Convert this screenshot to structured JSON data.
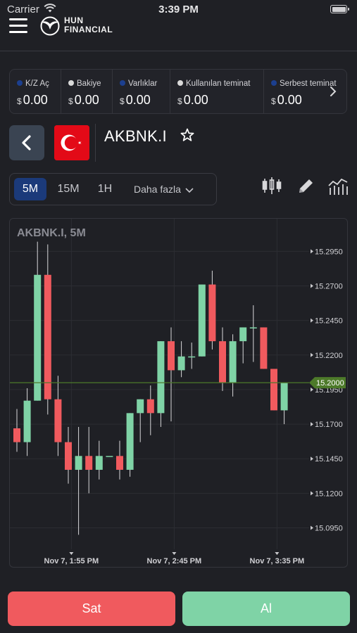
{
  "status_bar": {
    "carrier": "Carrier",
    "time": "3:39 PM"
  },
  "header": {
    "logo_line1": "HUN",
    "logo_line2": "FINANCIAL"
  },
  "stats": [
    {
      "label": "K/Z Aç",
      "dot_color": "#1c3f8f",
      "currency": "$",
      "value": "0.00"
    },
    {
      "label": "Bakiye",
      "dot_color": "#d9d9d9",
      "currency": "$",
      "value": "0.00"
    },
    {
      "label": "Varlıklar",
      "dot_color": "#1c3f8f",
      "currency": "$",
      "value": "0.00"
    },
    {
      "label": "Kullanılan teminat",
      "dot_color": "#d9d9d9",
      "currency": "$",
      "value": "0.00"
    },
    {
      "label": "Serbest teminat",
      "dot_color": "#1c3f8f",
      "currency": "$",
      "value": "0.00"
    }
  ],
  "symbol": {
    "name": "AKBNK.I",
    "flag": "turkey-flag"
  },
  "timeframes": {
    "items": [
      "5M",
      "15M",
      "1H"
    ],
    "active": "5M",
    "more_label": "Daha fazla"
  },
  "tools": [
    "candlestick-icon",
    "pencil-icon",
    "indicators-icon"
  ],
  "chart_data": {
    "type": "candlestick",
    "title": "AKBNK.I, 5M",
    "price_ticks": [
      "15.2950",
      "15.2700",
      "15.2450",
      "15.2200",
      "15.1950",
      "15.1700",
      "15.1450",
      "15.1200",
      "15.0950"
    ],
    "time_labels": [
      "Nov 7, 1:55 PM",
      "Nov 7, 2:45 PM",
      "Nov 7, 3:35 PM"
    ],
    "current_price": "15.2000",
    "ylim": [
      15.0795,
      15.3084
    ],
    "candles": [
      {
        "o": 15.167,
        "h": 15.181,
        "l": 15.15,
        "c": 15.157
      },
      {
        "o": 15.157,
        "h": 15.196,
        "l": 15.147,
        "c": 15.187
      },
      {
        "o": 15.187,
        "h": 15.302,
        "l": 15.187,
        "c": 15.278
      },
      {
        "o": 15.278,
        "h": 15.3,
        "l": 15.177,
        "c": 15.188
      },
      {
        "o": 15.188,
        "h": 15.205,
        "l": 15.147,
        "c": 15.157
      },
      {
        "o": 15.157,
        "h": 15.168,
        "l": 15.127,
        "c": 15.137
      },
      {
        "o": 15.137,
        "h": 15.168,
        "l": 15.09,
        "c": 15.147
      },
      {
        "o": 15.147,
        "h": 15.168,
        "l": 15.12,
        "c": 15.137
      },
      {
        "o": 15.137,
        "h": 15.158,
        "l": 15.13,
        "c": 15.147
      },
      {
        "o": 15.147,
        "h": 15.147,
        "l": 15.147,
        "c": 15.147
      },
      {
        "o": 15.147,
        "h": 15.158,
        "l": 15.13,
        "c": 15.137
      },
      {
        "o": 15.137,
        "h": 15.178,
        "l": 15.132,
        "c": 15.178
      },
      {
        "o": 15.178,
        "h": 15.188,
        "l": 15.157,
        "c": 15.188
      },
      {
        "o": 15.188,
        "h": 15.198,
        "l": 15.162,
        "c": 15.178
      },
      {
        "o": 15.178,
        "h": 15.23,
        "l": 15.168,
        "c": 15.23
      },
      {
        "o": 15.23,
        "h": 15.24,
        "l": 15.172,
        "c": 15.209
      },
      {
        "o": 15.209,
        "h": 15.23,
        "l": 15.204,
        "c": 15.219
      },
      {
        "o": 15.219,
        "h": 15.229,
        "l": 15.21,
        "c": 15.219
      },
      {
        "o": 15.219,
        "h": 15.271,
        "l": 15.219,
        "c": 15.271
      },
      {
        "o": 15.271,
        "h": 15.281,
        "l": 15.224,
        "c": 15.23
      },
      {
        "o": 15.23,
        "h": 15.24,
        "l": 15.194,
        "c": 15.2
      },
      {
        "o": 15.2,
        "h": 15.235,
        "l": 15.19,
        "c": 15.23
      },
      {
        "o": 15.23,
        "h": 15.24,
        "l": 15.214,
        "c": 15.24
      },
      {
        "o": 15.24,
        "h": 15.256,
        "l": 15.215,
        "c": 15.24
      },
      {
        "o": 15.24,
        "h": 15.24,
        "l": 15.21,
        "c": 15.21
      },
      {
        "o": 15.21,
        "h": 15.21,
        "l": 15.18,
        "c": 15.18
      },
      {
        "o": 15.18,
        "h": 15.2,
        "l": 15.17,
        "c": 15.2
      }
    ],
    "grid": true
  },
  "actions": {
    "sell_label": "Sat",
    "buy_label": "Al"
  },
  "colors": {
    "up": "#7fd3a6",
    "down": "#f05a5e",
    "accent": "#1b3a7a",
    "price_line": "#4d7a2a"
  }
}
